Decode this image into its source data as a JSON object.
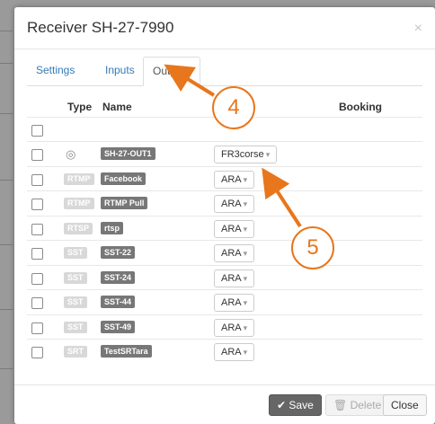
{
  "dialog": {
    "title": "Receiver SH-27-7990",
    "close_glyph": "×"
  },
  "tabs": [
    {
      "label": "Settings",
      "active": false
    },
    {
      "label": "Inputs",
      "active": false
    },
    {
      "label": "Outputs",
      "active": true
    }
  ],
  "table": {
    "headers": {
      "type": "Type",
      "name": "Name",
      "booking": "Booking"
    },
    "rows": [
      {
        "type": "",
        "type_icon": "target-icon",
        "name": "SH-27-OUT1",
        "booking": "FR3corse"
      },
      {
        "type": "RTMP",
        "name": "Facebook",
        "booking": "ARA"
      },
      {
        "type": "RTMP",
        "name": "RTMP Pull",
        "booking": "ARA"
      },
      {
        "type": "RTSP",
        "name": "rtsp",
        "booking": "ARA"
      },
      {
        "type": "SST",
        "name": "SST-22",
        "booking": "ARA"
      },
      {
        "type": "SST",
        "name": "SST-24",
        "booking": "ARA"
      },
      {
        "type": "SST",
        "name": "SST-44",
        "booking": "ARA"
      },
      {
        "type": "SST",
        "name": "SST-49",
        "booking": "ARA"
      },
      {
        "type": "SRT",
        "name": "TestSRTara",
        "booking": "ARA"
      }
    ]
  },
  "footer": {
    "save_label": "Save",
    "delete_label": "Delete",
    "close_label": "Close"
  },
  "annotations": {
    "callout_4": "4",
    "callout_5": "5",
    "accent_color": "#e8761c"
  }
}
